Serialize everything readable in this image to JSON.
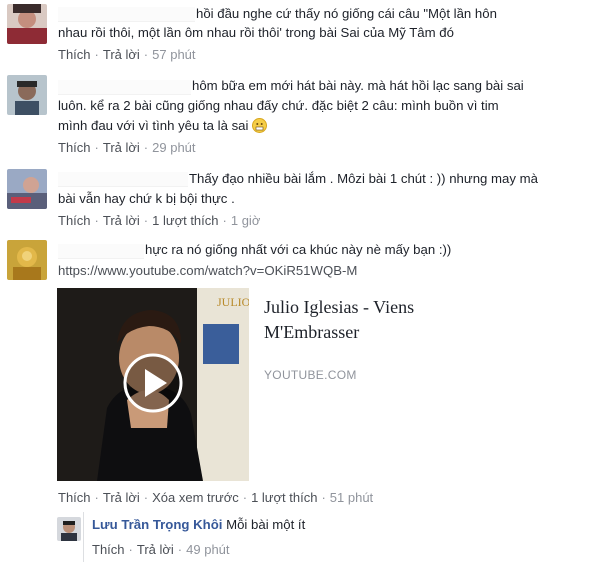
{
  "comments": [
    {
      "text_lines": [
        "hồi đầu nghe cứ thấy nó giống cái câu \"Một lần hôn",
        "nhau rồi thôi, một lần ôm nhau rồi thôi' trong bài Sai của Mỹ Tâm đó"
      ],
      "actions": {
        "like": "Thích",
        "reply": "Trả lời",
        "time": "57 phút"
      }
    },
    {
      "text_lines": [
        "hôm bữa em mới hát bài này. mà hát hồi lạc sang bài sai",
        "luôn. kể ra 2 bài cũng giống nhau đấy chứ. đặc biệt 2 câu: mình buồn vì tim",
        "mình đau với vì tình yêu ta là sai"
      ],
      "actions": {
        "like": "Thích",
        "reply": "Trả lời",
        "time": "29 phút"
      }
    },
    {
      "text_lines": [
        "Thấy đạo nhiều bài lắm . Môzi bài 1 chút : )) nhưng may mà",
        "bài vẫn hay chứ k bị bội thực ."
      ],
      "actions": {
        "like": "Thích",
        "reply": "Trả lời",
        "likes_count": "1 lượt thích",
        "time": "1 giờ"
      }
    },
    {
      "text_lines": [
        "hực ra nó giống nhất với ca khúc này nè mấy bạn :))"
      ],
      "url": "https://www.youtube.com/watch?v=OKiR51WQB-M",
      "card": {
        "title": "Julio Iglesias - Viens M'Embrasser",
        "domain": "YOUTUBE.COM",
        "album_text": "JULIO IGLESIAS"
      },
      "actions": {
        "like": "Thích",
        "reply": "Trả lời",
        "remove_preview": "Xóa xem trước",
        "likes_count": "1 lượt thích",
        "time": "51 phút"
      }
    }
  ],
  "reply": {
    "author": "Lưu Trần Trọng Khôi",
    "text": "Mỗi bài một ít",
    "actions": {
      "like": "Thích",
      "reply": "Trả lời",
      "time": "49 phút"
    }
  },
  "colors": {
    "link": "#365899",
    "meta": "#90949c",
    "action": "#4b4f56",
    "text": "#1d2129"
  }
}
